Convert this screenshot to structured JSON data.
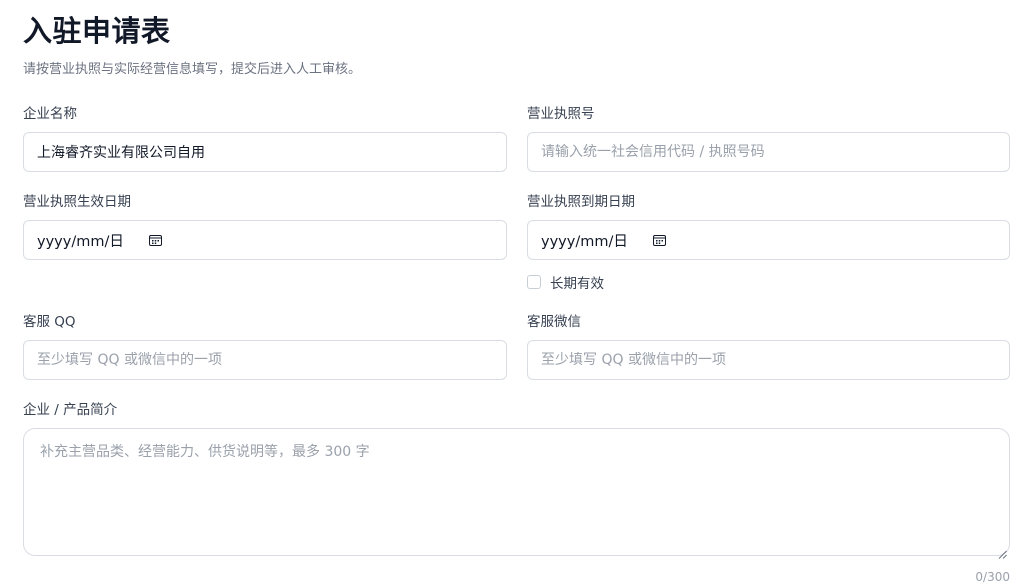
{
  "header": {
    "title": "入驻申请表",
    "subtitle": "请按营业执照与实际经营信息填写，提交后进入人工审核。"
  },
  "form": {
    "company_name": {
      "label": "企业名称",
      "value": "上海睿齐实业有限公司自用"
    },
    "license_no": {
      "label": "营业执照号",
      "placeholder": "请输入统一社会信用代码 / 执照号码"
    },
    "license_start": {
      "label": "营业执照生效日期",
      "display": "yyyy/mm/日"
    },
    "license_end": {
      "label": "营业执照到期日期",
      "display": "yyyy/mm/日"
    },
    "long_term": {
      "label": "长期有效",
      "checked": false
    },
    "service_qq": {
      "label": "客服 QQ",
      "placeholder": "至少填写 QQ 或微信中的一项"
    },
    "service_wechat": {
      "label": "客服微信",
      "placeholder": "至少填写 QQ 或微信中的一项"
    },
    "intro": {
      "label": "企业 / 产品简介",
      "placeholder": "补充主营品类、经营能力、供货说明等，最多 300 字",
      "counter": "0/300"
    }
  },
  "icons": {
    "date_picker": "calendar-icon",
    "resize": "resize-handle-icon"
  },
  "colors": {
    "border": "#d9dde3",
    "placeholder": "#9aa1ab",
    "title": "#111827",
    "subtitle": "#6b7280"
  }
}
